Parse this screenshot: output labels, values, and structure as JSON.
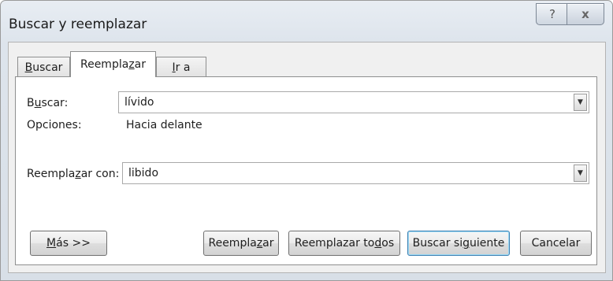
{
  "window": {
    "title": "Buscar y reemplazar"
  },
  "title_controls": {
    "help_glyph": "?",
    "close_glyph": "x"
  },
  "tabs": [
    {
      "pre": "",
      "u": "B",
      "post": "uscar",
      "active": false
    },
    {
      "pre": "Reempla",
      "u": "z",
      "post": "ar",
      "active": true
    },
    {
      "pre": "",
      "u": "I",
      "post": "r a",
      "active": false
    }
  ],
  "find": {
    "label_pre": "B",
    "label_u": "u",
    "label_post": "scar:",
    "value": "lívido"
  },
  "options": {
    "label": "Opciones:",
    "value": "Hacia delante"
  },
  "replace": {
    "label_pre": "Reempla",
    "label_u": "z",
    "label_post": "ar con:",
    "value": "libido"
  },
  "buttons": {
    "more": {
      "pre": "",
      "u": "M",
      "post": "ás >>"
    },
    "replace": {
      "pre": "Reempla",
      "u": "z",
      "post": "ar"
    },
    "replace_all": {
      "pre": "Reemplazar to",
      "u": "d",
      "post": "os"
    },
    "find_next": {
      "pre": "Buscar si",
      "u": "g",
      "post": "uiente"
    },
    "cancel": {
      "pre": "Cancelar",
      "u": "",
      "post": ""
    }
  }
}
